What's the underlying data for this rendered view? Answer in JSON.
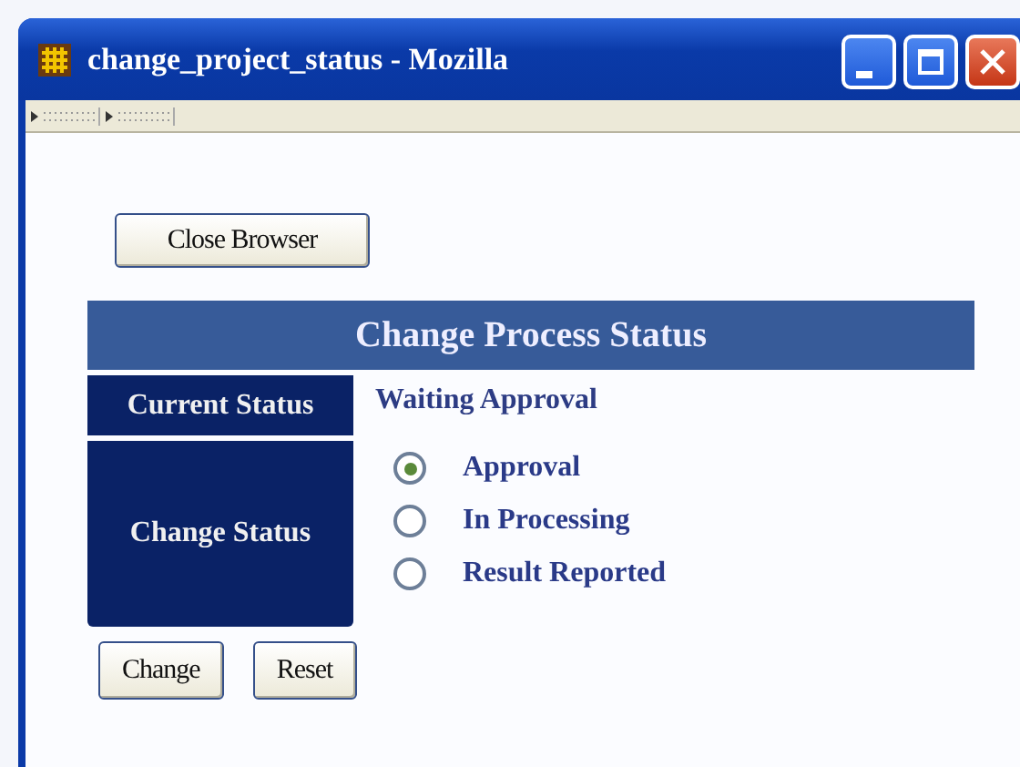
{
  "window": {
    "title": "change_project_status - Mozilla"
  },
  "close_button": {
    "label": "Close Browser"
  },
  "form": {
    "title": "Change Process Status",
    "current_status": {
      "label": "Current Status",
      "value": "Waiting Approval"
    },
    "change_status": {
      "label": "Change Status",
      "options": [
        {
          "label": "Approval",
          "selected": true
        },
        {
          "label": "In Processing",
          "selected": false
        },
        {
          "label": "Result Reported",
          "selected": false
        }
      ]
    },
    "buttons": [
      "Change",
      "Reset"
    ]
  }
}
